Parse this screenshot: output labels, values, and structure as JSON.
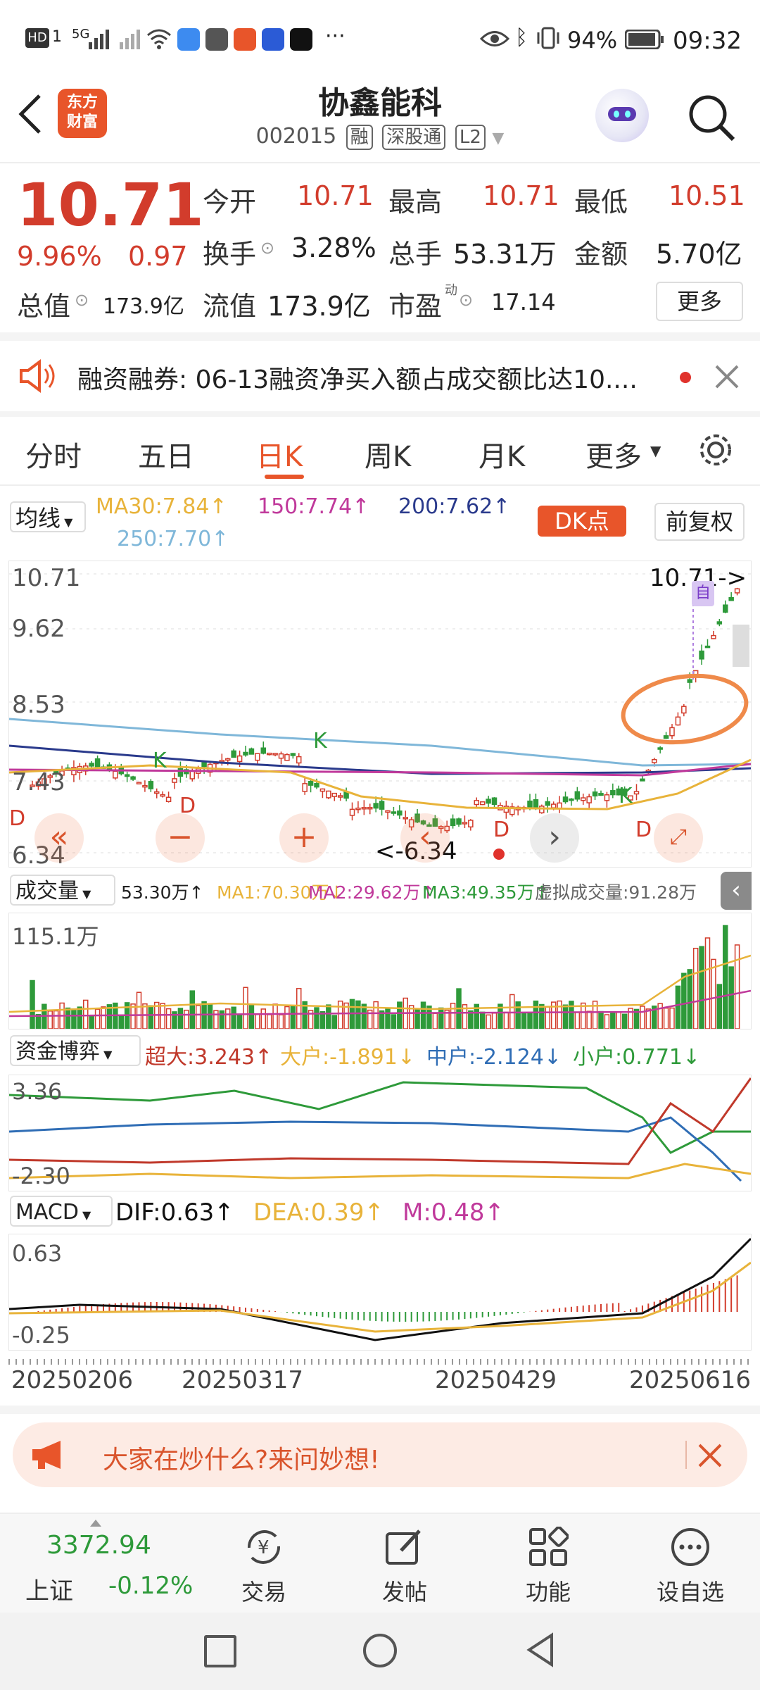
{
  "status": {
    "left_icons": [
      "HD",
      "1",
      "5G",
      "wifi"
    ],
    "battery": "94%",
    "time": "09:32"
  },
  "header": {
    "title": "协鑫能科",
    "code": "002015",
    "tags": [
      "融",
      "深股通",
      "L2"
    ],
    "logo_text": "东方\n财富"
  },
  "quote": {
    "price": "10.71",
    "change_pct": "9.96%",
    "change": "0.97",
    "open_label": "今开",
    "open": "10.71",
    "high_label": "最高",
    "high": "10.71",
    "low_label": "最低",
    "low": "10.51",
    "turnover_label": "换手",
    "turnover": "3.28%",
    "volume_label": "总手",
    "volume": "53.31万",
    "amount_label": "金额",
    "amount": "5.70亿",
    "total_cap_label": "总值",
    "total_cap": "173.9亿",
    "float_cap_label": "流值",
    "float_cap": "173.9亿",
    "pe_label": "市盈",
    "pe_sup": "动",
    "pe": "17.14",
    "more_button": "更多"
  },
  "notice": {
    "text": "融资融券:  06-13融资净买入额占成交额比达10...."
  },
  "tabs": [
    {
      "label": "分时"
    },
    {
      "label": "五日"
    },
    {
      "label": "日K"
    },
    {
      "label": "周K"
    },
    {
      "label": "月K"
    },
    {
      "label": "更多"
    }
  ],
  "ma_bar": {
    "selector": "均线",
    "ma30": "MA30:7.84↑",
    "ma150": "150:7.74↑",
    "ma200": "200:7.62↑",
    "ma250": "250:7.70↑",
    "dk_button": "DK点",
    "adjust_button": "前复权"
  },
  "kchart": {
    "axis": [
      "10.71",
      "9.62",
      "8.53",
      "7.43",
      "6.34"
    ],
    "last_label": "10.71->",
    "min_label": "<-6.34",
    "mark_k": "K",
    "mark_d": "D",
    "mark_self": "自"
  },
  "volume_bar": {
    "selector": "成交量",
    "vol": "53.30万↑",
    "ma1": "MA1:70.30万↓",
    "ma2": "MA2:29.62万↑",
    "ma3": "MA3:49.35万↑",
    "virtual": "虚拟成交量:91.28万",
    "axis_max": "115.1万"
  },
  "capital_bar": {
    "selector": "资金博弈",
    "super": "超大:3.243↑",
    "large": "大户:-1.891↓",
    "mid": "中户:-2.124↓",
    "small": "小户:0.771↓",
    "axis_top": "3.36",
    "axis_bottom": "-2.30"
  },
  "macd_bar": {
    "selector": "MACD",
    "dif": "DIF:0.63↑",
    "dea": "DEA:0.39↑",
    "m": "M:0.48↑",
    "axis_top": "0.63",
    "axis_bottom": "-0.25"
  },
  "dates": [
    "20250206",
    "20250317",
    "20250429",
    "20250616"
  ],
  "ask_banner": {
    "text": "大家在炒什么?来问妙想!"
  },
  "bottom_nav": {
    "index_value": "3372.94",
    "index_name": "上证",
    "index_change": "-0.12%",
    "items": [
      {
        "label": "交易"
      },
      {
        "label": "发帖"
      },
      {
        "label": "功能"
      },
      {
        "label": "设自选"
      }
    ]
  },
  "colors": {
    "up": "#d23c2c",
    "down": "#2e9a3a",
    "brand": "#e8552a",
    "ma30": "#e8b33a",
    "ma150": "#c0399b",
    "ma200": "#2a3a8c",
    "ma250": "#7fb7d9"
  }
}
